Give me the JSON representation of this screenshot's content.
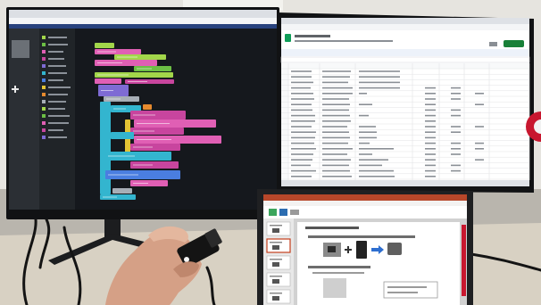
{
  "colors": {
    "wall": "#e6e4df",
    "wall_light": "#f3f2ee",
    "wall_shadow": "#b9b5ad",
    "desk": "#d8d1c3",
    "stand": "#1c1d1f",
    "cable": "#141414",
    "bezel": "#111214",
    "browser_chrome": "#dcdfe4",
    "address_bar": "#f4f5f7",
    "editor_header": "#28427e",
    "editor_bg": "#15181d",
    "editor_sidebar": "#2b2f34",
    "editor_category_panel": "#202428",
    "editor_placeholder": "#6b7076",
    "category_text": "#8b9199",
    "sheet_bg": "#ffffff",
    "sheet_chrome": "#dee1e6",
    "sheet_toolbar": "#edf2fa",
    "sheet_header": "#f8f9fa",
    "sheet_grid": "#e2e3e5",
    "sheet_text": "#8a8f95",
    "sheet_title": "#5f6368",
    "sheets_green": "#0f9d58",
    "share_green": "#188038",
    "ppt_red": "#b7472a",
    "ppt_ribbon": "#f3f2f1",
    "ppt_pane": "#e8e8e8",
    "ppt_canvas": "#d1d1d1",
    "ppt_selected": "#c43e1c",
    "ribbon_green": "#3ba55c",
    "ribbon_blue": "#2b6cb0",
    "slide_bg": "#ffffff",
    "slide_text": "#6d6d6d",
    "slide_arrow": "#2e6fd0",
    "skin": "#d5a086",
    "skin_light": "#e4b79e",
    "skin_shadow": "#bf876d",
    "device": "#141414",
    "device_part": "#2a2a2a",
    "device_led": "#f4f4f4",
    "accent_red": "#c8172f",
    "laptop_bezel": "#1f2022"
  },
  "block_colors": {
    "lime": "#a2d64a",
    "green": "#6cbf45",
    "pink": "#e05fb4",
    "magenta": "#c8459e",
    "purple": "#7e6bd4",
    "cyan": "#33b5cf",
    "blue": "#4a7ee0",
    "yellow": "#e3c334",
    "orange": "#e68a2e",
    "gray": "#a7aeb6"
  },
  "icons": {
    "spreadsheet_app": "sheets-icon",
    "presentation_app": "powerpoint-icon",
    "add": "plus-icon",
    "arrow": "arrow-right-icon"
  }
}
